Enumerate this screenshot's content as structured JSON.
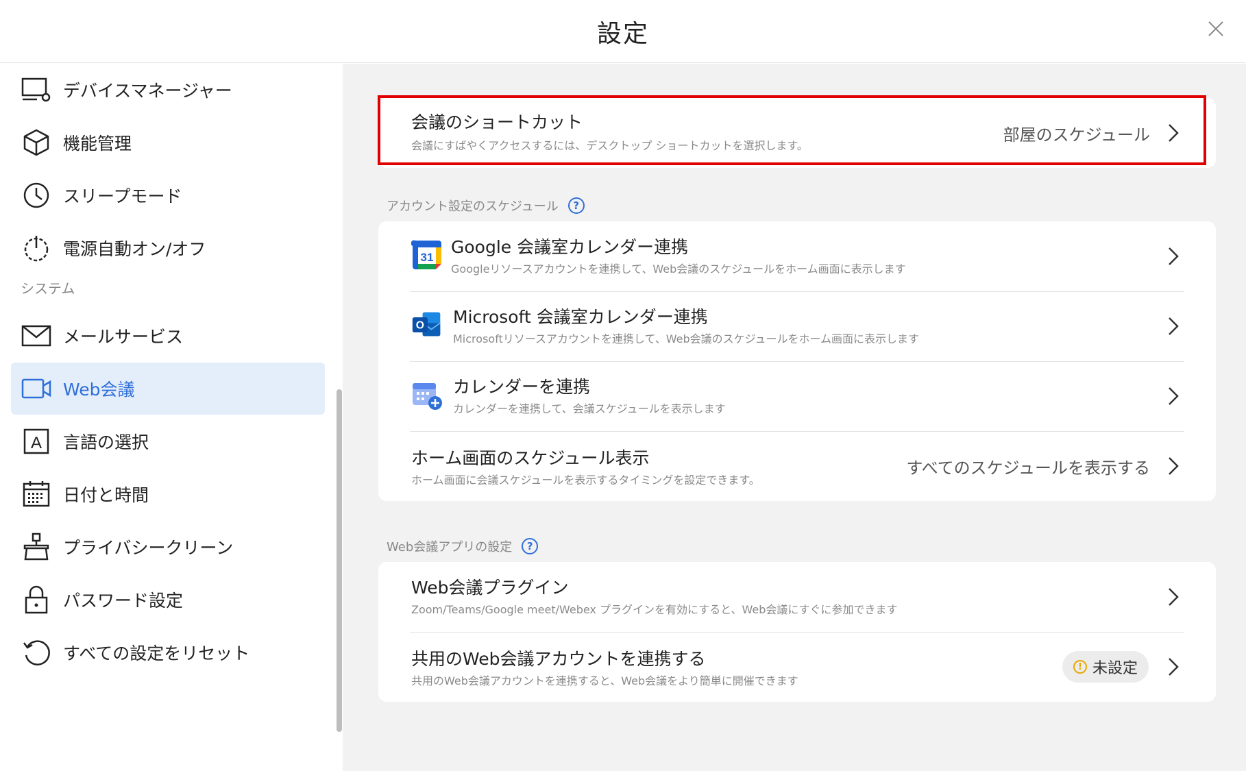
{
  "header": {
    "title": "設定",
    "close_icon": "close-icon"
  },
  "sidebar": {
    "items_top": [
      {
        "label": "デバイスマネージャー",
        "icon": "device-manager-icon"
      },
      {
        "label": "機能管理",
        "icon": "cube-icon"
      },
      {
        "label": "スリープモード",
        "icon": "clock-icon"
      },
      {
        "label": "電源自動オン/オフ",
        "icon": "power-icon"
      }
    ],
    "section_system": "システム",
    "items_system": [
      {
        "label": "メールサービス",
        "icon": "mail-icon"
      },
      {
        "label": "Web会議",
        "icon": "video-icon",
        "active": true
      },
      {
        "label": "言語の選択",
        "icon": "language-icon"
      },
      {
        "label": "日付と時間",
        "icon": "calendar-icon"
      },
      {
        "label": "プライバシークリーン",
        "icon": "broom-icon"
      },
      {
        "label": "パスワード設定",
        "icon": "lock-icon"
      },
      {
        "label": "すべての設定をリセット",
        "icon": "reset-icon"
      }
    ]
  },
  "main": {
    "shortcut": {
      "title": "会議のショートカット",
      "desc": "会議にすばやくアクセスするには、デスクトップ ショートカットを選択します。",
      "value": "部屋のスケジュール"
    },
    "account_section": {
      "label": "アカウント設定のスケジュール",
      "rows": [
        {
          "title": "Google 会議室カレンダー連携",
          "desc": "Googleリソースアカウントを連携して、Web会議のスケジュールをホーム画面に表示します",
          "icon": "google-calendar-icon"
        },
        {
          "title": "Microsoft 会議室カレンダー連携",
          "desc": "Microsoftリソースアカウントを連携して、Web会議のスケジュールをホーム画面に表示します",
          "icon": "outlook-icon"
        },
        {
          "title": "カレンダーを連携",
          "desc": "カレンダーを連携して、会議スケジュールを表示します",
          "icon": "calendar-add-icon"
        },
        {
          "title": "ホーム画面のスケジュール表示",
          "desc": "ホーム画面に会議スケジュールを表示するタイミングを設定できます。",
          "value": "すべてのスケジュールを表示する"
        }
      ]
    },
    "webapp_section": {
      "label": "Web会議アプリの設定",
      "rows": [
        {
          "title": "Web会議プラグイン",
          "desc": "Zoom/Teams/Google meet/Webex プラグインを有効にすると、Web会議にすぐに参加できます"
        },
        {
          "title": "共用のWeb会議アカウントを連携する",
          "desc": "共用のWeb会議アカウントを連携すると、Web会議をより簡単に開催できます",
          "badge": "未設定"
        }
      ]
    },
    "colors": {
      "accent": "#2f6fd8",
      "highlight": "#e00000",
      "warning": "#e8a800"
    }
  }
}
